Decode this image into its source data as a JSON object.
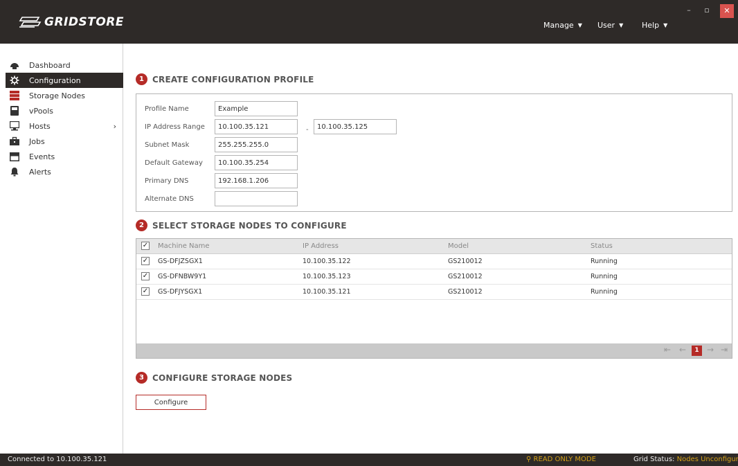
{
  "app": {
    "logo_text": "GRIDSTORE",
    "menu": [
      {
        "label": "Manage"
      },
      {
        "label": "User"
      },
      {
        "label": "Help"
      }
    ],
    "accent_color": "#b52b27",
    "titlebar_color": "#2e2a28"
  },
  "sidebar": {
    "items": [
      {
        "label": "Dashboard",
        "icon": "dashboard-icon"
      },
      {
        "label": "Configuration",
        "icon": "gear-icon",
        "active": true
      },
      {
        "label": "Storage Nodes",
        "icon": "storage-nodes-icon"
      },
      {
        "label": "vPools",
        "icon": "vpool-icon"
      },
      {
        "label": "Hosts",
        "icon": "monitor-icon",
        "has_submenu": true
      },
      {
        "label": "Jobs",
        "icon": "briefcase-icon"
      },
      {
        "label": "Events",
        "icon": "calendar-icon"
      },
      {
        "label": "Alerts",
        "icon": "bell-icon"
      }
    ]
  },
  "step1": {
    "number": "1",
    "title": "CREATE CONFIGURATION PROFILE",
    "fields": {
      "profile_name": {
        "label": "Profile Name",
        "value": "Example"
      },
      "ip_range": {
        "label": "IP Address Range",
        "start": "10.100.35.121",
        "separator": "-",
        "end": "10.100.35.125"
      },
      "subnet_mask": {
        "label": "Subnet Mask",
        "value": "255.255.255.0"
      },
      "default_gateway": {
        "label": "Default Gateway",
        "value": "10.100.35.254"
      },
      "primary_dns": {
        "label": "Primary DNS",
        "value": "192.168.1.206"
      },
      "alternate_dns": {
        "label": "Alternate DNS",
        "value": ""
      }
    }
  },
  "step2": {
    "number": "2",
    "title": "SELECT STORAGE NODES TO CONFIGURE",
    "columns": [
      "Machine Name",
      "IP Address",
      "Model",
      "Status"
    ],
    "rows": [
      {
        "checked": true,
        "machine": "GS-DFJZSGX1",
        "ip": "10.100.35.122",
        "model": "GS210012",
        "status": "Running"
      },
      {
        "checked": true,
        "machine": "GS-DFNBW9Y1",
        "ip": "10.100.35.123",
        "model": "GS210012",
        "status": "Running"
      },
      {
        "checked": true,
        "machine": "GS-DFJYSGX1",
        "ip": "10.100.35.121",
        "model": "GS210012",
        "status": "Running"
      }
    ],
    "pager": {
      "current_page": "1"
    }
  },
  "step3": {
    "number": "3",
    "title": "CONFIGURE STORAGE NODES",
    "button_label": "Configure"
  },
  "status": {
    "connection": "Connected to 10.100.35.121",
    "mode": "READ ONLY MODE",
    "grid_label": "Grid Status:",
    "grid_value": "Nodes Unconfigured"
  }
}
